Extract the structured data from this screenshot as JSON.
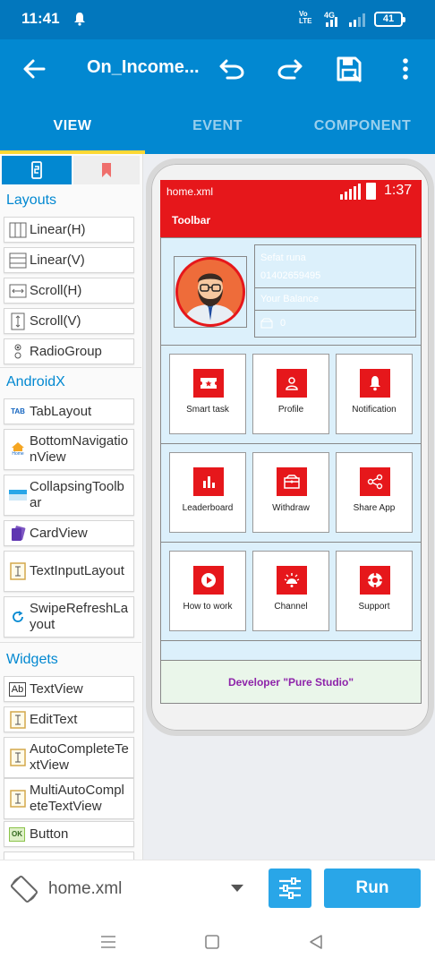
{
  "status_bar": {
    "time": "11:41",
    "network_label": "Vo LTE",
    "network_top": "Vo",
    "network_bottom": "LTE",
    "network_type": "4G",
    "battery": "41"
  },
  "app_bar": {
    "title": "On_Income...",
    "icons": [
      "back-arrow-icon",
      "undo-icon",
      "redo-icon",
      "save-icon",
      "more-vert-icon"
    ]
  },
  "tabs": [
    {
      "label": "VIEW",
      "active": true
    },
    {
      "label": "EVENT",
      "active": false
    },
    {
      "label": "COMPONENT",
      "active": false
    }
  ],
  "palette": {
    "sections": [
      {
        "title": "Layouts",
        "items": [
          {
            "label": "Linear(H)",
            "icon": "linear-h-icon"
          },
          {
            "label": "Linear(V)",
            "icon": "linear-v-icon"
          },
          {
            "label": "Scroll(H)",
            "icon": "scroll-h-icon"
          },
          {
            "label": "Scroll(V)",
            "icon": "scroll-v-icon"
          },
          {
            "label": "RadioGroup",
            "icon": "radiogroup-icon"
          }
        ]
      },
      {
        "title": "AndroidX",
        "items": [
          {
            "label": "TabLayout",
            "icon": "tablayout-icon"
          },
          {
            "label": "BottomNavigationView",
            "icon": "bottomnav-icon"
          },
          {
            "label": "CollapsingToolbar",
            "icon": "collapsing-toolbar-icon"
          },
          {
            "label": "CardView",
            "icon": "cardview-icon"
          },
          {
            "label": "TextInputLayout",
            "icon": "textinputlayout-icon"
          },
          {
            "label": "SwipeRefreshLayout",
            "icon": "swiperefresh-icon"
          }
        ]
      },
      {
        "title": "Widgets",
        "items": [
          {
            "label": "TextView",
            "icon": "textview-icon"
          },
          {
            "label": "EditText",
            "icon": "edittext-icon"
          },
          {
            "label": "AutoCompleteTextView",
            "icon": "autocomplete-icon"
          },
          {
            "label": "MultiAutoCompleteTextView",
            "icon": "multiautocomplete-icon"
          },
          {
            "label": "Button",
            "icon": "button-icon"
          }
        ]
      }
    ],
    "icon_text": {
      "tab": "TAB",
      "ab": "Ab",
      "ok": "OK",
      "home": "Home"
    }
  },
  "preview": {
    "file": "home.xml",
    "time": "1:37",
    "toolbar_title": "Toolbar",
    "profile": {
      "name": "Sefat runa",
      "phone": "01402659495",
      "balance_label": "Your Balance",
      "balance_value": "0"
    },
    "cards": [
      {
        "label": "Smart task",
        "icon": "ticket-icon"
      },
      {
        "label": "Profile",
        "icon": "person-icon"
      },
      {
        "label": "Notification",
        "icon": "bell-icon"
      },
      {
        "label": "Leaderboard",
        "icon": "bar-chart-icon"
      },
      {
        "label": "Withdraw",
        "icon": "wallet-icon"
      },
      {
        "label": "Share App",
        "icon": "share-icon"
      },
      {
        "label": "How to work",
        "icon": "play-icon"
      },
      {
        "label": "Channel",
        "icon": "lamp-icon"
      },
      {
        "label": "Support",
        "icon": "support-icon"
      }
    ],
    "footer": "Developer \"Pure Studio\""
  },
  "bottom_bar": {
    "file": "home.xml",
    "run_label": "Run"
  },
  "colors": {
    "app_bar": "#0288d1",
    "status_bar": "#0277bd",
    "tab_indicator": "#fdd835",
    "preview_red": "#e6171b",
    "preview_bg": "#dcf0fb",
    "footer_text": "#8e24aa",
    "run_button": "#29a6e8"
  }
}
